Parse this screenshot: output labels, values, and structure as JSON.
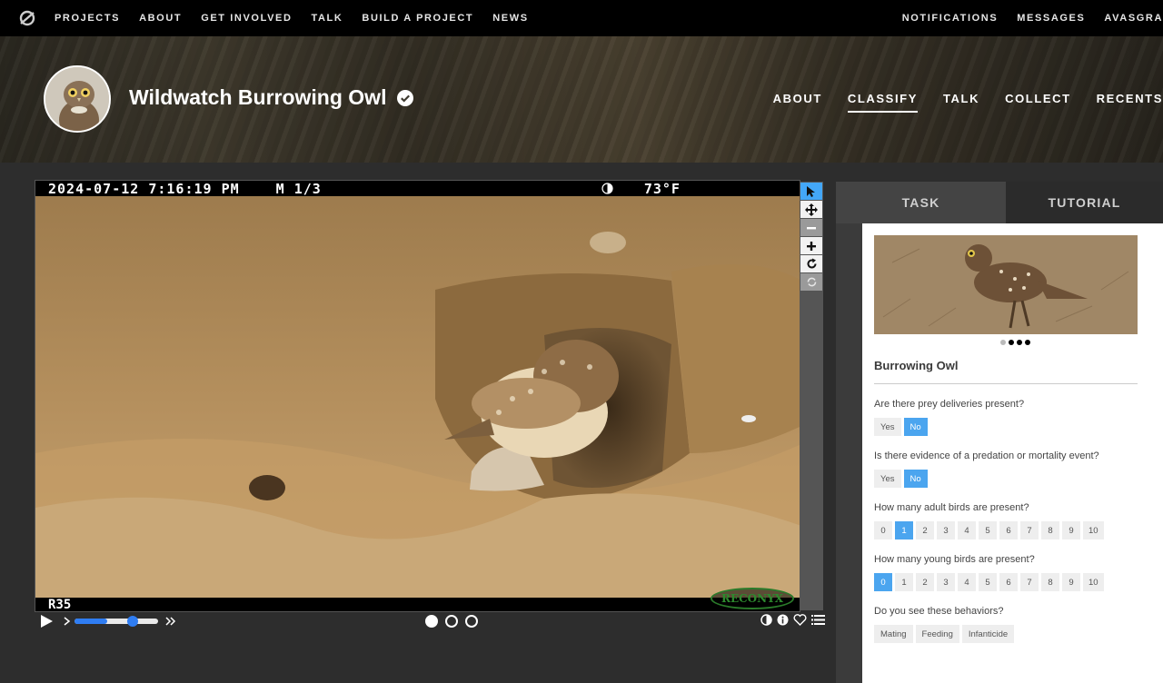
{
  "topnav": {
    "items": [
      "PROJECTS",
      "ABOUT",
      "GET INVOLVED",
      "TALK",
      "BUILD A PROJECT",
      "NEWS"
    ],
    "right": [
      "NOTIFICATIONS",
      "MESSAGES",
      "AVASGRA"
    ]
  },
  "project": {
    "title": "Wildwatch Burrowing Owl",
    "nav": [
      "ABOUT",
      "CLASSIFY",
      "TALK",
      "COLLECT",
      "RECENTS"
    ],
    "active_nav": "CLASSIFY"
  },
  "viewer": {
    "timestamp": "2024-07-12 7:16:19 PM",
    "frame": "M 1/3",
    "temperature": "73°F",
    "camera": "R35",
    "brand": "RECONYX",
    "frames_count": 3,
    "current_frame": 1
  },
  "panel": {
    "tabs": [
      "TASK",
      "TUTORIAL"
    ],
    "species": "Burrowing Owl",
    "questions": [
      {
        "text": "Are there prey deliveries present?",
        "options": [
          "Yes",
          "No"
        ],
        "selected": "No"
      },
      {
        "text": "Is there evidence of a predation or mortality event?",
        "options": [
          "Yes",
          "No"
        ],
        "selected": "No"
      },
      {
        "text": "How many adult birds are present?",
        "options": [
          "0",
          "1",
          "2",
          "3",
          "4",
          "5",
          "6",
          "7",
          "8",
          "9",
          "10"
        ],
        "selected": "1"
      },
      {
        "text": "How many young birds are present?",
        "options": [
          "0",
          "1",
          "2",
          "3",
          "4",
          "5",
          "6",
          "7",
          "8",
          "9",
          "10"
        ],
        "selected": "0"
      },
      {
        "text": "Do you see these behaviors?",
        "options": [
          "Mating",
          "Feeding",
          "Infanticide"
        ],
        "selected": ""
      }
    ]
  },
  "colors": {
    "accent": "#43a7f8",
    "selected_option": "#4ba5ef",
    "slider": "#2f7df2"
  }
}
